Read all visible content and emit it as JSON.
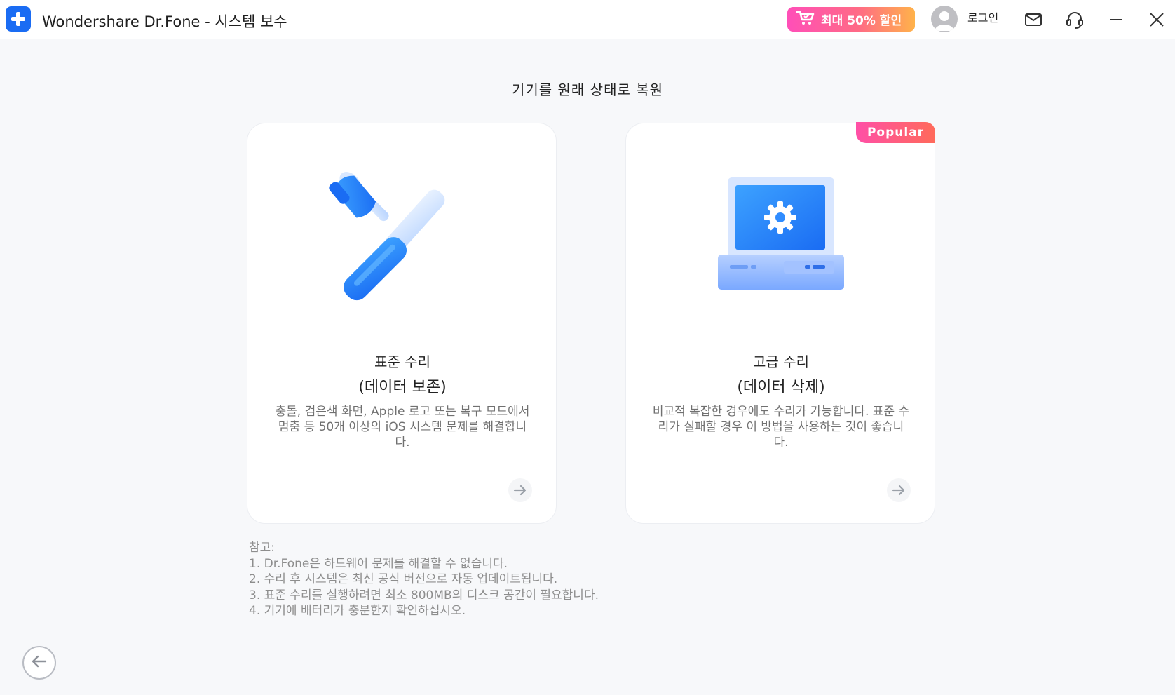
{
  "window": {
    "title": "Wondershare Dr.Fone - 시스템 보수",
    "promo_label": "최대 50% 할인",
    "login_label": "로그인"
  },
  "main": {
    "heading": "기기를 원래 상태로 복원",
    "cards": [
      {
        "title": "표준 수리",
        "subtitle": "(데이터 보존)",
        "description": "충돌, 검은색 화면, Apple 로고 또는 복구 모드에서 멈춤 등 50개 이상의 iOS 시스템 문제를 해결합니다."
      },
      {
        "title": "고급 수리",
        "subtitle": "(데이터 삭제)",
        "description": "비교적 복잡한 경우에도 수리가 가능합니다. 표준 수리가 실패할 경우 이 방법을 사용하는 것이 좋습니다.",
        "badge": "Popular"
      }
    ]
  },
  "notes": {
    "heading": "참고:",
    "items": [
      "1. Dr.Fone은 하드웨어 문제를 해결할 수 없습니다.",
      "2. 수리 후 시스템은 최신 공식 버전으로 자동 업데이트됩니다.",
      "3. 표준 수리를 실행하려면 최소 800MB의 디스크 공간이 필요합니다.",
      "4. 기기에 배터리가 충분한지 확인하십시오."
    ]
  },
  "colors": {
    "accent": "#1a6cf3",
    "promo_start": "#ff4fb8",
    "promo_end": "#ffb24a",
    "badge": "#ff5b8a"
  },
  "icons": [
    "app-logo-icon",
    "cart-icon",
    "avatar-icon",
    "mail-icon",
    "headset-icon",
    "minimize-icon",
    "close-icon",
    "tools-icon",
    "computer-gear-icon",
    "arrow-right-icon",
    "arrow-left-icon"
  ]
}
